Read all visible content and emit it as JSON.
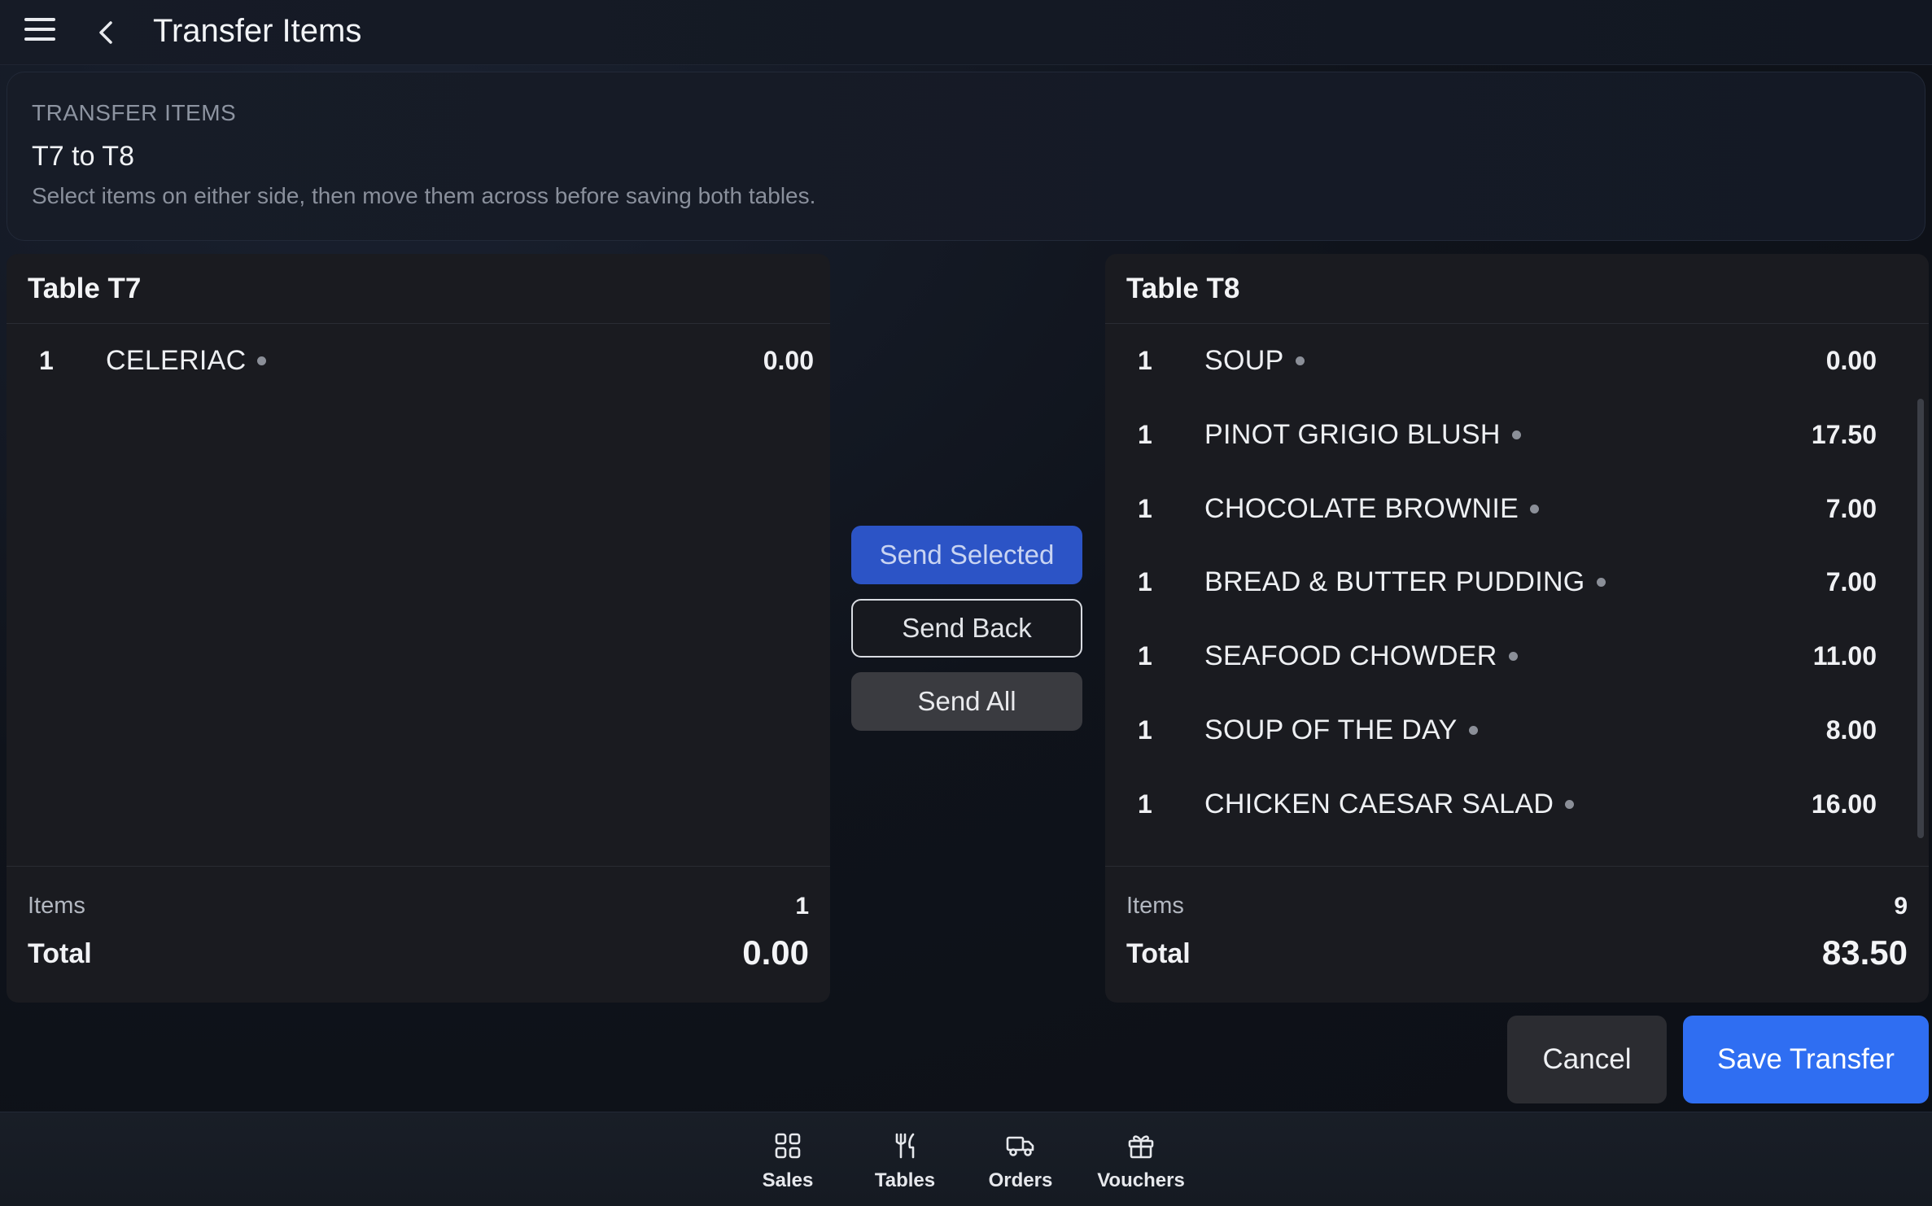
{
  "topbar": {
    "title": "Transfer Items",
    "icons": {
      "menu": "hamburger-menu-icon",
      "back": "chevron-left-icon"
    }
  },
  "header": {
    "eyebrow": "TRANSFER ITEMS",
    "title": "T7 to T8",
    "description": "Select items on either side, then move them across before saving both tables."
  },
  "left_table": {
    "title": "Table T7",
    "items": [
      {
        "qty": "1",
        "name": "CELERIAC",
        "price": "0.00"
      }
    ],
    "footer": {
      "items_label": "Items",
      "items_count": "1",
      "total_label": "Total",
      "total": "0.00"
    }
  },
  "right_table": {
    "title": "Table T8",
    "items": [
      {
        "qty": "1",
        "name": "SOUP",
        "price": "0.00"
      },
      {
        "qty": "1",
        "name": "PINOT GRIGIO BLUSH",
        "price": "17.50"
      },
      {
        "qty": "1",
        "name": "CHOCOLATE BROWNIE",
        "price": "7.00"
      },
      {
        "qty": "1",
        "name": "BREAD & BUTTER PUDDING",
        "price": "7.00"
      },
      {
        "qty": "1",
        "name": "SEAFOOD CHOWDER",
        "price": "11.00"
      },
      {
        "qty": "1",
        "name": "SOUP OF THE DAY",
        "price": "8.00"
      },
      {
        "qty": "1",
        "name": "CHICKEN CAESAR SALAD",
        "price": "16.00"
      }
    ],
    "footer": {
      "items_label": "Items",
      "items_count": "9",
      "total_label": "Total",
      "total": "83.50"
    }
  },
  "transfer_actions": {
    "send_selected": "Send Selected",
    "send_back": "Send Back",
    "send_all": "Send All"
  },
  "actions": {
    "cancel": "Cancel",
    "save": "Save Transfer"
  },
  "bottom_nav": [
    {
      "label": "Sales",
      "icon": "grid-icon"
    },
    {
      "label": "Tables",
      "icon": "fork-knife-icon"
    },
    {
      "label": "Orders",
      "icon": "delivery-truck-icon"
    },
    {
      "label": "Vouchers",
      "icon": "gift-icon"
    }
  ],
  "colors": {
    "primary": "#2f6ef2",
    "send_selected_bg": "#2c54c6",
    "panel_bg": "#1a1b20",
    "background": "#0f131b"
  }
}
